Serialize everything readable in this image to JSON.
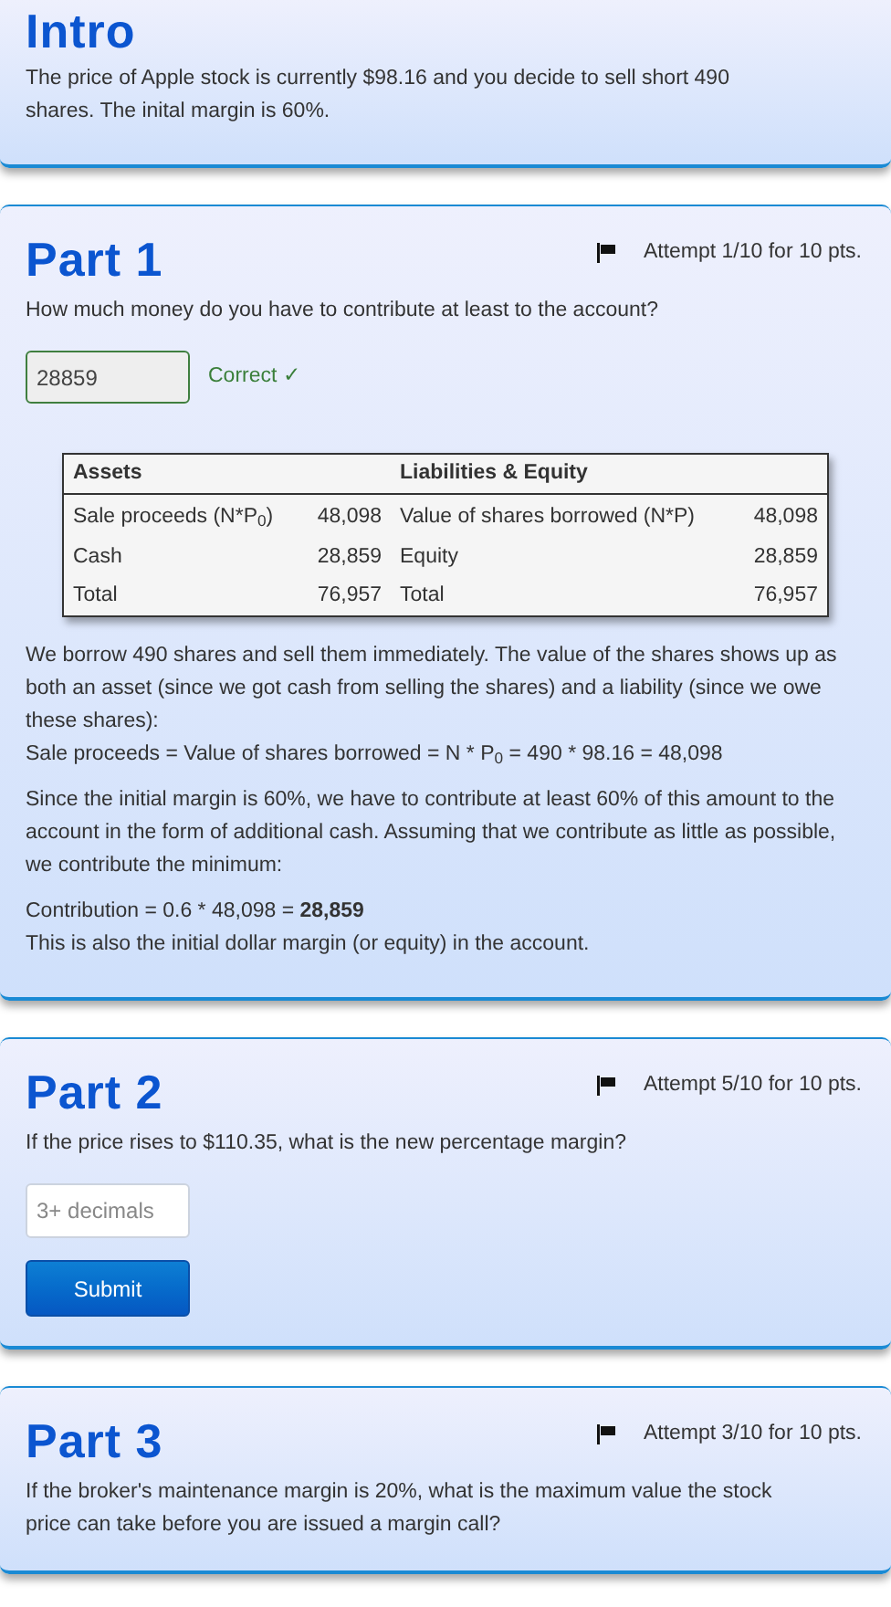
{
  "intro": {
    "title": "Intro",
    "text": "The price of Apple stock is currently $98.16 and you decide to sell short 490 shares. The inital margin is 60%."
  },
  "parts": [
    {
      "title": "Part 1",
      "attempt": "Attempt 1/10 for 10 pts.",
      "question": "How much money do you have to contribute at least to the account?",
      "answer": {
        "value": "28859",
        "correct": true,
        "feedback": "Correct ✓"
      },
      "balance_sheet": [
        {
          "heading": "Assets",
          "lines": [
            {
              "label": "Sale proceeds (N*P$_{0}$)",
              "amount": "48,098"
            },
            {
              "label": "Cash",
              "amount": "28,859"
            },
            {
              "label": "Total",
              "amount": "76,957"
            }
          ]
        },
        {
          "heading": "Liabilities & Equity",
          "lines": [
            {
              "label": "Value of shares borrowed (N*P)",
              "amount": "48,098"
            },
            {
              "label": "Equity",
              "amount": "28,859"
            },
            {
              "label": "Total",
              "amount": "76,957"
            }
          ]
        }
      ],
      "explanation": [
        [
          "We borrow 490 shares and sell them immediately. The value of the shares shows up as both an asset (since we got cash from selling the shares) and a liability (since we owe these shares):",
          "Sale proceeds = Value of shares borrowed = N * P$_{0}$ = 490 * 98.16 = 48,098"
        ],
        [
          "Since the initial margin is 60%, we have to contribute at least 60% of this amount to the account in the form of additional cash. Assuming that we contribute as little as possible, we contribute the minimum:"
        ],
        [
          "Contribution = 0.6 * 48,098 = **28,859**",
          "This is also the initial dollar margin (or equity) in the account."
        ]
      ]
    },
    {
      "title": "Part 2",
      "attempt": "Attempt 5/10 for 10 pts.",
      "question": "If the price rises to $110.35, what is the new percentage margin?",
      "answer": {
        "placeholder": "3+ decimals"
      },
      "button": "Submit"
    },
    {
      "title": "Part 3",
      "attempt": "Attempt 3/10 for 10 pts.",
      "question": "If the broker's maintenance margin is 20%, what is the maximum value the stock price can take before you are issued a margin call?"
    }
  ]
}
